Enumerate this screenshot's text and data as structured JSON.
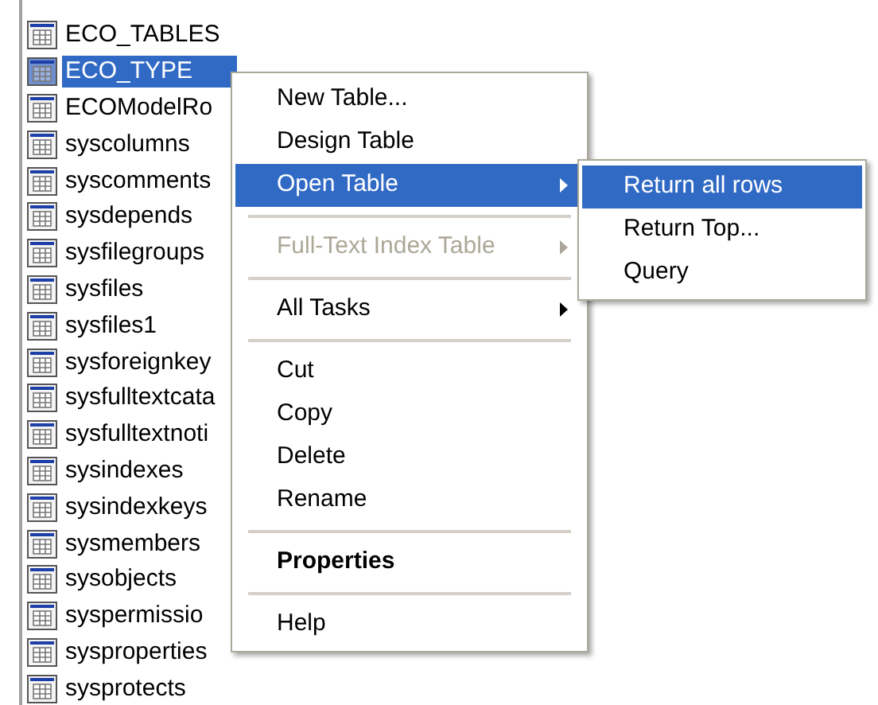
{
  "tables": [
    {
      "name": "ECO_TABLES",
      "selected": false
    },
    {
      "name": "ECO_TYPE",
      "selected": true
    },
    {
      "name": "ECOModelRo",
      "selected": false
    },
    {
      "name": "syscolumns",
      "selected": false
    },
    {
      "name": "syscomments",
      "selected": false
    },
    {
      "name": "sysdepends",
      "selected": false
    },
    {
      "name": "sysfilegroups",
      "selected": false
    },
    {
      "name": "sysfiles",
      "selected": false
    },
    {
      "name": "sysfiles1",
      "selected": false
    },
    {
      "name": "sysforeignkey",
      "selected": false
    },
    {
      "name": "sysfulltextcata",
      "selected": false
    },
    {
      "name": "sysfulltextnoti",
      "selected": false
    },
    {
      "name": "sysindexes",
      "selected": false
    },
    {
      "name": "sysindexkeys",
      "selected": false
    },
    {
      "name": "sysmembers",
      "selected": false
    },
    {
      "name": "sysobjects",
      "selected": false
    },
    {
      "name": "syspermissio",
      "selected": false
    },
    {
      "name": "sysproperties",
      "selected": false
    },
    {
      "name": "sysprotects",
      "selected": false
    }
  ],
  "context_menu": [
    {
      "kind": "item",
      "label": "New Table...",
      "selected": false,
      "disabled": false,
      "default": false,
      "has_submenu": false
    },
    {
      "kind": "item",
      "label": "Design Table",
      "selected": false,
      "disabled": false,
      "default": false,
      "has_submenu": false
    },
    {
      "kind": "item",
      "label": "Open Table",
      "selected": true,
      "disabled": false,
      "default": false,
      "has_submenu": true
    },
    {
      "kind": "separator"
    },
    {
      "kind": "item",
      "label": "Full-Text Index Table",
      "selected": false,
      "disabled": true,
      "default": false,
      "has_submenu": true
    },
    {
      "kind": "separator"
    },
    {
      "kind": "item",
      "label": "All Tasks",
      "selected": false,
      "disabled": false,
      "default": false,
      "has_submenu": true
    },
    {
      "kind": "separator"
    },
    {
      "kind": "item",
      "label": "Cut",
      "selected": false,
      "disabled": false,
      "default": false,
      "has_submenu": false
    },
    {
      "kind": "item",
      "label": "Copy",
      "selected": false,
      "disabled": false,
      "default": false,
      "has_submenu": false
    },
    {
      "kind": "item",
      "label": "Delete",
      "selected": false,
      "disabled": false,
      "default": false,
      "has_submenu": false
    },
    {
      "kind": "item",
      "label": "Rename",
      "selected": false,
      "disabled": false,
      "default": false,
      "has_submenu": false
    },
    {
      "kind": "separator"
    },
    {
      "kind": "item",
      "label": "Properties",
      "selected": false,
      "disabled": false,
      "default": true,
      "has_submenu": false
    },
    {
      "kind": "separator"
    },
    {
      "kind": "item",
      "label": "Help",
      "selected": false,
      "disabled": false,
      "default": false,
      "has_submenu": false
    }
  ],
  "submenu": [
    {
      "label": "Return all rows",
      "selected": true
    },
    {
      "label": "Return Top...",
      "selected": false
    },
    {
      "label": "Query",
      "selected": false
    }
  ]
}
